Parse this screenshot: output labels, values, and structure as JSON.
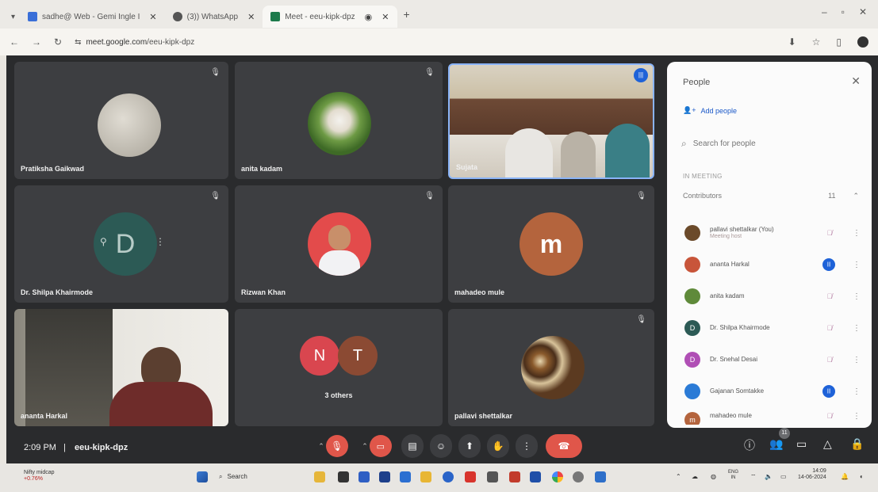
{
  "browser": {
    "tabs": [
      {
        "label": "sadhe@ Web - Gemi Ingle I",
        "active": false
      },
      {
        "label": "(3)) WhatsApp",
        "active": false
      },
      {
        "label": "Meet - eeu-kipk-dpz",
        "active": true
      }
    ],
    "url_prefix": "meet.google.com",
    "url_path": "/eeu-kipk-dpz"
  },
  "tiles": [
    {
      "name": "Pratiksha Gaikwad",
      "avatar_color": "#c9c4ba"
    },
    {
      "name": "anita kadam",
      "avatar_color": "#5f8a3a"
    },
    {
      "name": "Sujata",
      "avatar_color": ""
    },
    {
      "name": "Dr. Shilpa Khairmode",
      "avatar_letter": "D",
      "avatar_color": "#2c5a55"
    },
    {
      "name": "Rizwan Khan",
      "avatar_color": "#e34b4b"
    },
    {
      "name": "mahadeo mule",
      "avatar_letter": "m",
      "avatar_color": "#b4643d"
    },
    {
      "name": "ananta Harkal",
      "avatar_color": ""
    },
    {
      "name": "3 others",
      "avatar_letters": [
        "N",
        "T"
      ],
      "avatar_colors": [
        "#d9464f",
        "#8b4a33"
      ]
    },
    {
      "name": "pallavi shettalkar",
      "avatar_color": "#6b4a2a"
    }
  ],
  "panel": {
    "title": "People",
    "add_people": "Add people",
    "search_placeholder": "Search for people",
    "in_meeting_label": "IN MEETING",
    "contributors_label": "Contributors",
    "contributors_count": "11",
    "people": [
      {
        "name": "pallavi shettalkar (You)",
        "sub": "Meeting host",
        "color": "#6b4a2a",
        "mic": "muted"
      },
      {
        "name": "ananta Harkal",
        "sub": "",
        "color": "#c8553a",
        "mic": "active"
      },
      {
        "name": "anita kadam",
        "sub": "",
        "color": "#5f8a3a",
        "mic": "muted"
      },
      {
        "name": "Dr. Shilpa Khairmode",
        "sub": "",
        "color": "#2c5a55",
        "letter": "D",
        "mic": "muted"
      },
      {
        "name": "Dr. Snehal Desai",
        "sub": "",
        "color": "#b04fb5",
        "letter": "D",
        "mic": "muted"
      },
      {
        "name": "Gajanan Somtakke",
        "sub": "",
        "color": "#2b7bd6",
        "mic": "active"
      },
      {
        "name": "mahadeo mule",
        "sub": "",
        "color": "#b4643d",
        "letter": "m",
        "mic": "muted"
      }
    ]
  },
  "toolbar": {
    "time": "2:09 PM",
    "meeting_code": "eeu-kipk-dpz",
    "people_badge": "11"
  },
  "taskbar": {
    "stock_name": "Nifty midcap",
    "stock_change": "+0.76%",
    "search_label": "Search",
    "lang": "ENG",
    "region": "IN",
    "clock_time": "14:09",
    "clock_date": "14-06-2024"
  },
  "colors": {
    "meet_bg": "#2a2b2d",
    "tile_bg": "#3d3e41",
    "end_call": "#e0564a",
    "accent_blue": "#1e62d8"
  }
}
